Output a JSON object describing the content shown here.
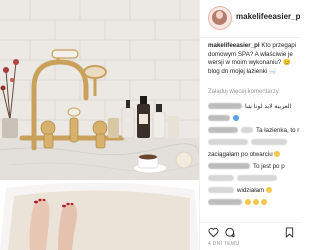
{
  "header": {
    "username": "makelifeeasier_pl"
  },
  "caption": {
    "username": "makelifeeasier_pl",
    "line1": "Kto przegapi",
    "line2": "domowym SPA? A właściwie je",
    "line3": "wersji w moim wykonaniu? 😊",
    "line4": "blog dn mojej łazienki 🛁"
  },
  "load_more": "Załaduj więcej komentarzy",
  "comments": [
    {
      "text": "العربية لابد لونا شا"
    },
    {
      "text": ""
    },
    {
      "text": "Ta łazienka, to r"
    },
    {
      "text": ""
    },
    {
      "text": "zaciągałam po otwarciu"
    },
    {
      "text": "To jest po p"
    },
    {
      "text": ""
    },
    {
      "text": "widziałam"
    },
    {
      "text": ""
    }
  ],
  "footer": {
    "date": "4 DNI TEMU"
  },
  "icons": [
    "heart-icon",
    "comment-icon",
    "bookmark-icon"
  ],
  "colors": {
    "accent_heart": "#ed4956",
    "text": "#262626",
    "muted": "#999999",
    "divider": "#efefef"
  }
}
